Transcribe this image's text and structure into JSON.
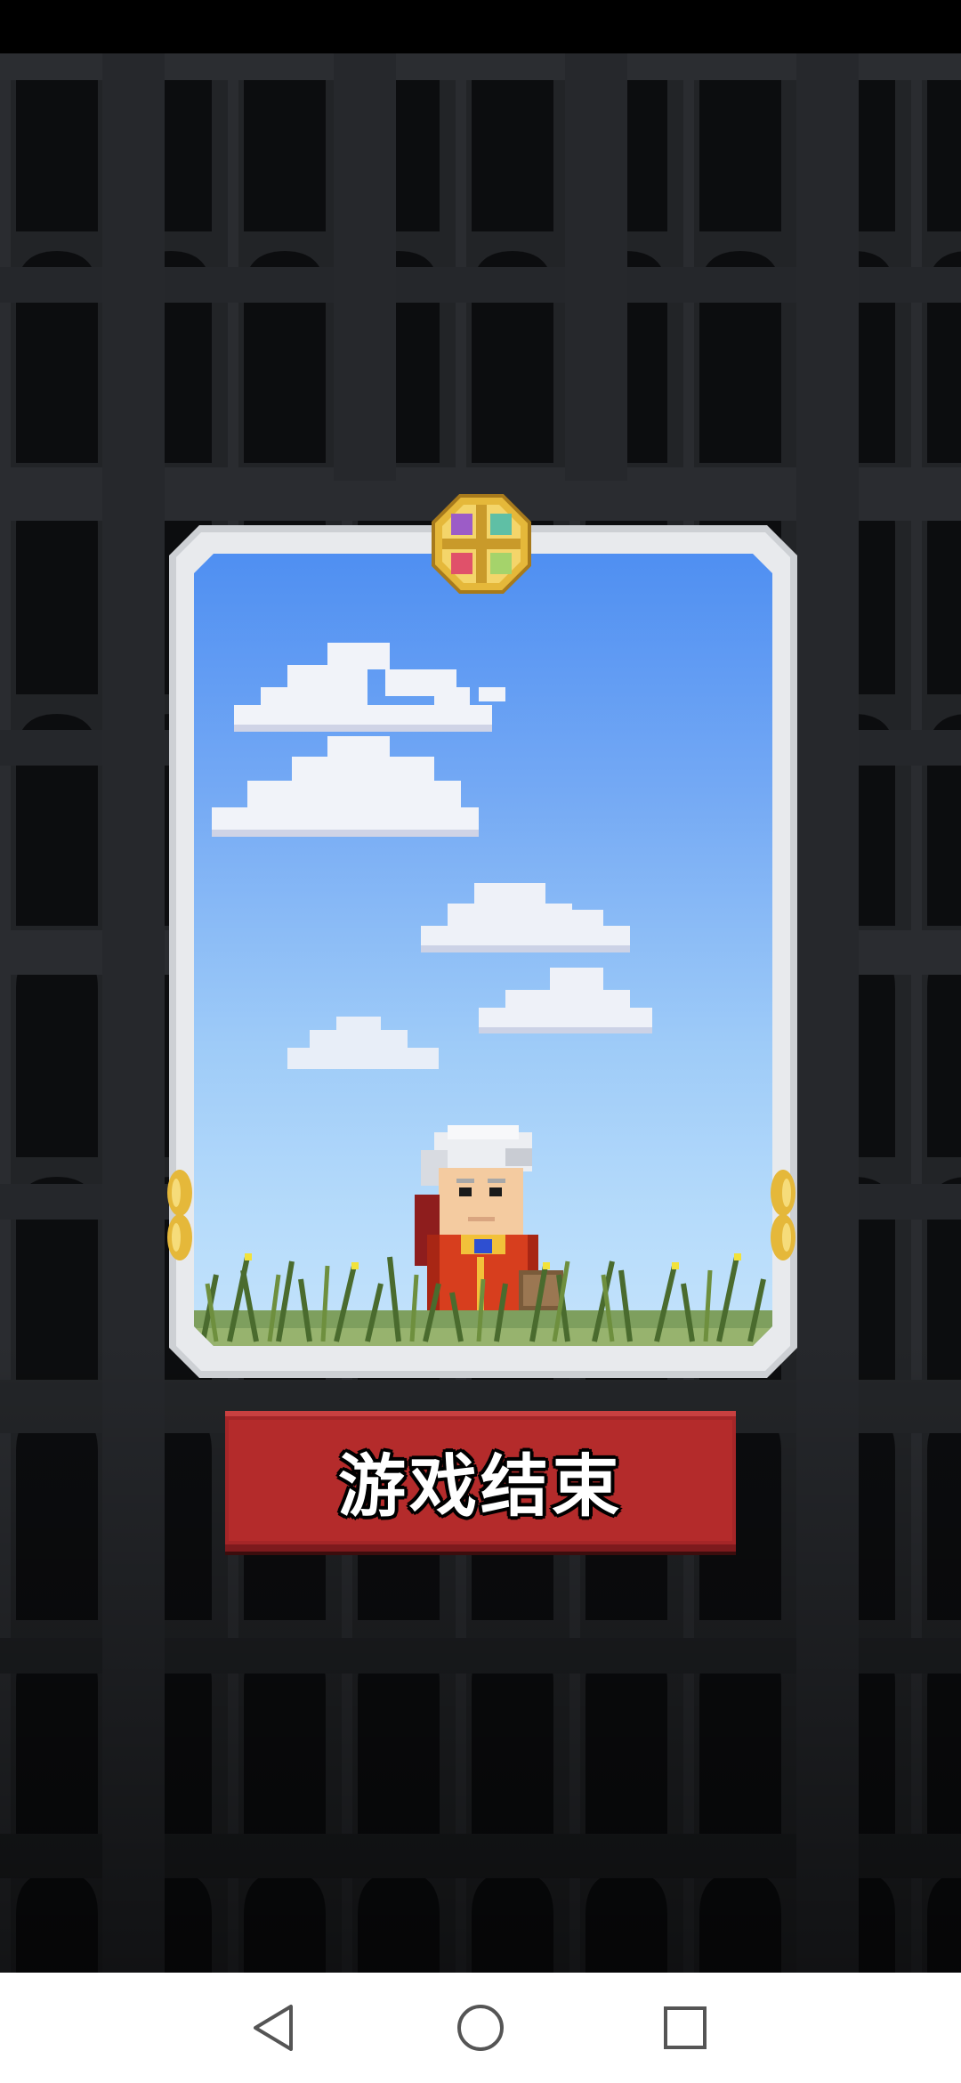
{
  "game": {
    "game_over_label": "游戏结束"
  },
  "colors": {
    "background": "#16181b",
    "sky_top": "#4f8ff2",
    "sky_bottom": "#c4e3fb",
    "button_red": "#b42b2b",
    "card_frame": "#cdd0d4",
    "gold": "#e5b83a"
  },
  "icons": {
    "nav_back": "back-triangle-icon",
    "nav_home": "home-circle-icon",
    "nav_recents": "recents-square-icon",
    "emblem": "gold-cross-emblem-icon"
  }
}
